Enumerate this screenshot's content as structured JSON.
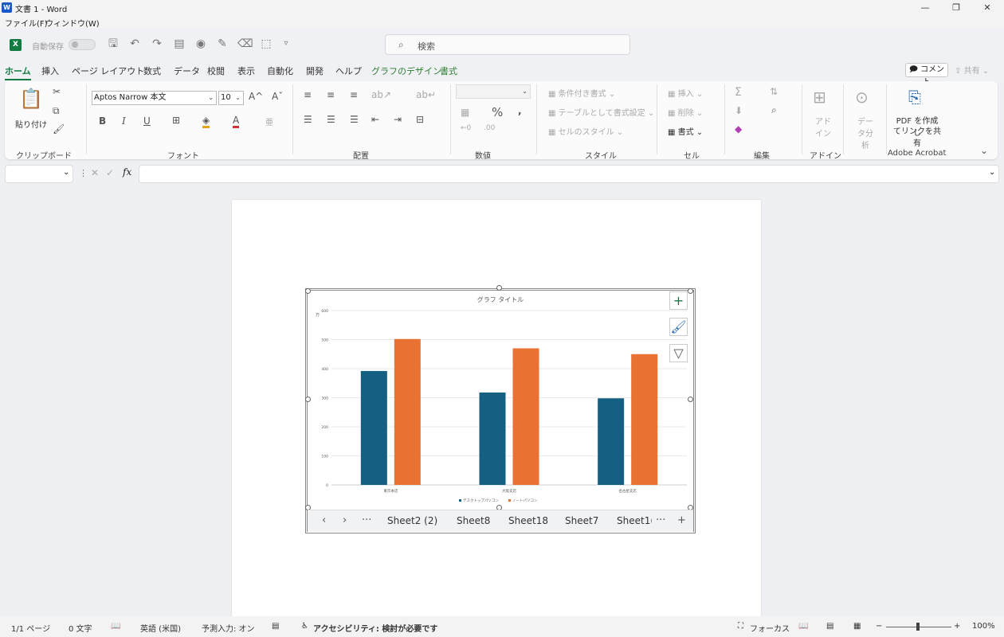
{
  "window": {
    "title": "文書 1 - Word",
    "minimize": "—",
    "restore": "❐",
    "close": "✕"
  },
  "menu": {
    "file": "ファイル(F)",
    "window": "ウィンドウ(W)"
  },
  "qat": {
    "autosave": "自動保存",
    "autosave_state": "オフ",
    "search_placeholder": "検索"
  },
  "tabs": [
    "ホーム",
    "挿入",
    "ページ レイアウト",
    "数式",
    "データ",
    "校閲",
    "表示",
    "自動化",
    "開発",
    "ヘルプ",
    "グラフのデザイン",
    "書式"
  ],
  "comment_button": "コメント",
  "share_button": "共有",
  "ribbon": {
    "clipboard": {
      "paste": "貼り付け",
      "label": "クリップボード"
    },
    "font": {
      "name": "Aptos Narrow 本文",
      "size": "10",
      "label": "フォント"
    },
    "alignment": {
      "label": "配置"
    },
    "number": {
      "label": "数値"
    },
    "styles": {
      "cond": "条件付き書式",
      "table": "テーブルとして書式設定",
      "cell": "セルのスタイル",
      "label": "スタイル"
    },
    "cells": {
      "insert": "挿入",
      "delete": "削除",
      "format": "書式",
      "label": "セル"
    },
    "edit": {
      "label": "編集"
    },
    "addins": {
      "btn": "アドイン",
      "label": "アドイン"
    },
    "analysis": {
      "btn": "データ分析"
    },
    "acrobat": {
      "btn1": "PDF を作成し",
      "btn2": "てリンクを共有",
      "label": "Adobe Acrobat"
    }
  },
  "formula_bar": {
    "fx": "fx"
  },
  "chart_data": {
    "type": "bar",
    "title": "グラフ タイトル",
    "ylabel": "万",
    "categories": [
      "東京本店",
      "大阪支店",
      "名古屋支店"
    ],
    "series": [
      {
        "name": "デスクトップパソコン",
        "values": [
          392,
          318,
          298
        ],
        "color": "#156082"
      },
      {
        "name": "ノートパソコン",
        "values": [
          502,
          470,
          450
        ],
        "color": "#e97132"
      }
    ],
    "ylim": [
      0,
      600
    ],
    "yticks": [
      0,
      100,
      200,
      300,
      400,
      500,
      600
    ],
    "grid": true,
    "legend": "bottom"
  },
  "sheets": [
    "Sheet2 (2)",
    "Sheet8",
    "Sheet18",
    "Sheet7",
    "Sheet1("
  ],
  "status": {
    "page": "1/1 ページ",
    "words": "0 文字",
    "lang": "英語 (米国)",
    "predict": "予測入力: オン",
    "access": "アクセシビリティ: 検討が必要です",
    "focus": "フォーカス",
    "zoom": "100%"
  }
}
